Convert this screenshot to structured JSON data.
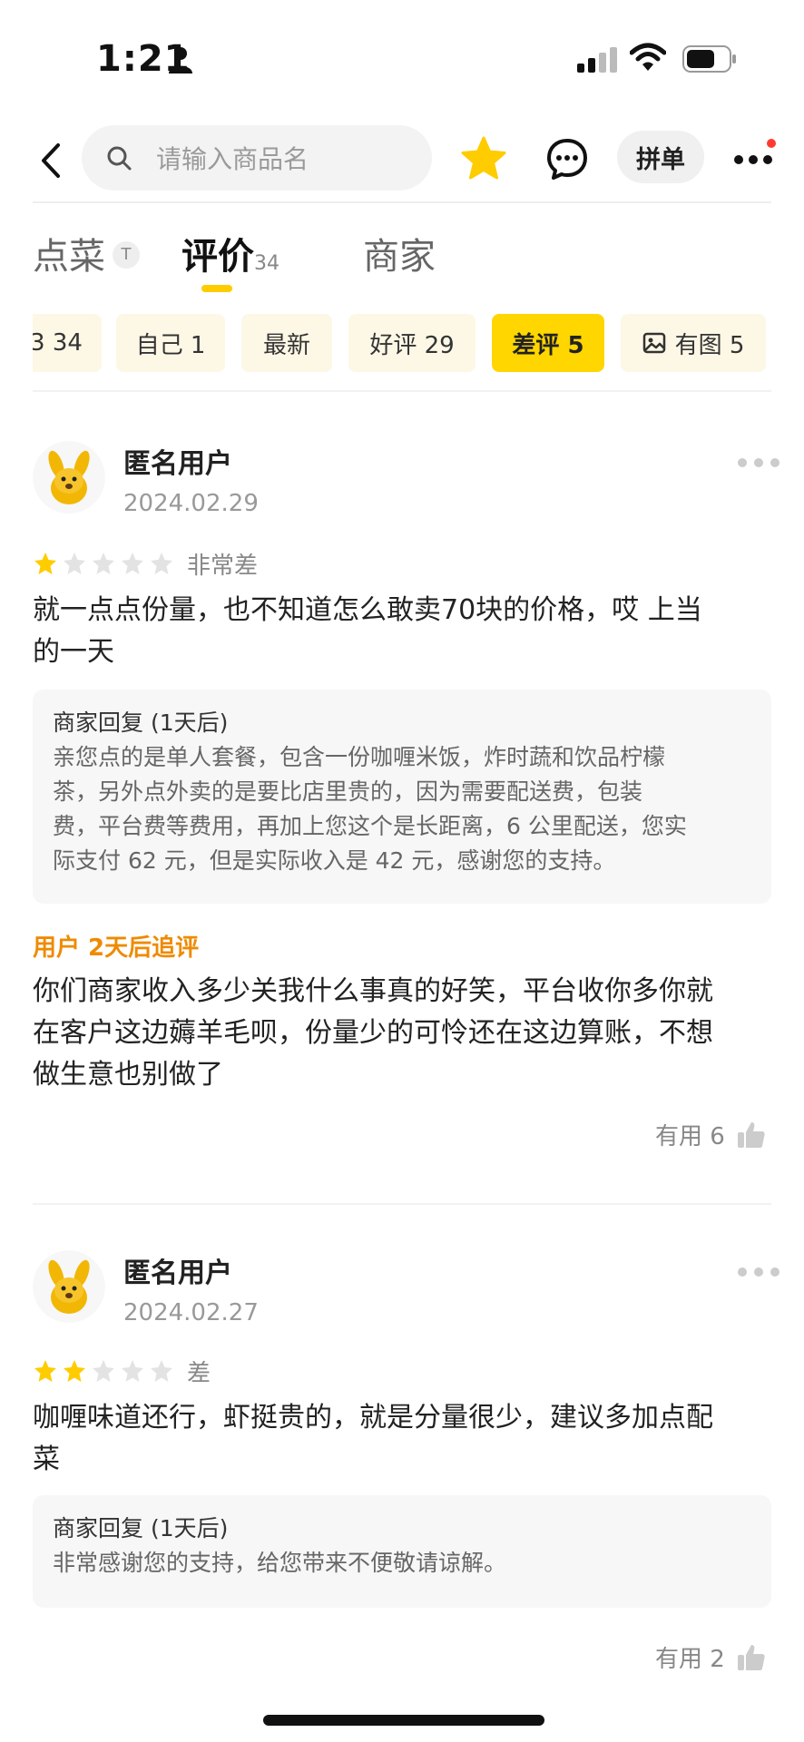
{
  "status_bar": {
    "time": "1:21"
  },
  "nav": {
    "search_placeholder": "请输入商品名",
    "group_order_label": "拼单"
  },
  "tabs": [
    {
      "label": "点菜",
      "badge": "T"
    },
    {
      "label": "评价",
      "count": "34"
    },
    {
      "label": "商家"
    }
  ],
  "filters": [
    {
      "label": "3 34"
    },
    {
      "label": "自己 1"
    },
    {
      "label": "最新"
    },
    {
      "label": "好评 29"
    },
    {
      "label": "差评 5",
      "active": true
    },
    {
      "label": "有图 5"
    }
  ],
  "reviews": [
    {
      "username": "匿名用户",
      "date": "2024.02.29",
      "stars": 1,
      "rating_text": "非常差",
      "text_lines": [
        "就一点点份量，也不知道怎么敢卖70块的价格，哎 上当",
        "的一天"
      ],
      "reply_title": "商家回复 (1天后)",
      "reply_lines": [
        "亲您点的是单人套餐，包含一份咖喱米饭，炸时蔬和饮品柠檬",
        "茶，另外点外卖的是要比店里贵的，因为需要配送费，包装",
        "费，平台费等费用，再加上您这个是长距离，6 公里配送，您实",
        "际支付 62 元，但是实际收入是 42 元，感谢您的支持。"
      ],
      "followup_label": "用户 2天后追评",
      "followup_lines": [
        "你们商家收入多少关我什么事真的好笑，平台收你多你就",
        "在客户这边薅羊毛呗，份量少的可怜还在这边算账，不想",
        "做生意也别做了"
      ],
      "useful_label": "有用 6"
    },
    {
      "username": "匿名用户",
      "date": "2024.02.27",
      "stars": 2,
      "rating_text": "差",
      "text_lines": [
        "咖喱味道还行，虾挺贵的，就是分量很少，建议多加点配",
        "菜"
      ],
      "reply_title": "商家回复 (1天后)",
      "reply_lines": [
        "非常感谢您的支持，给您带来不便敬请谅解。"
      ],
      "useful_label": "有用 2"
    }
  ],
  "colors": {
    "accent": "#ffd600",
    "followup": "#ef8a00",
    "star_active": "#ffcc00",
    "star_inactive": "#e3e3e3"
  }
}
